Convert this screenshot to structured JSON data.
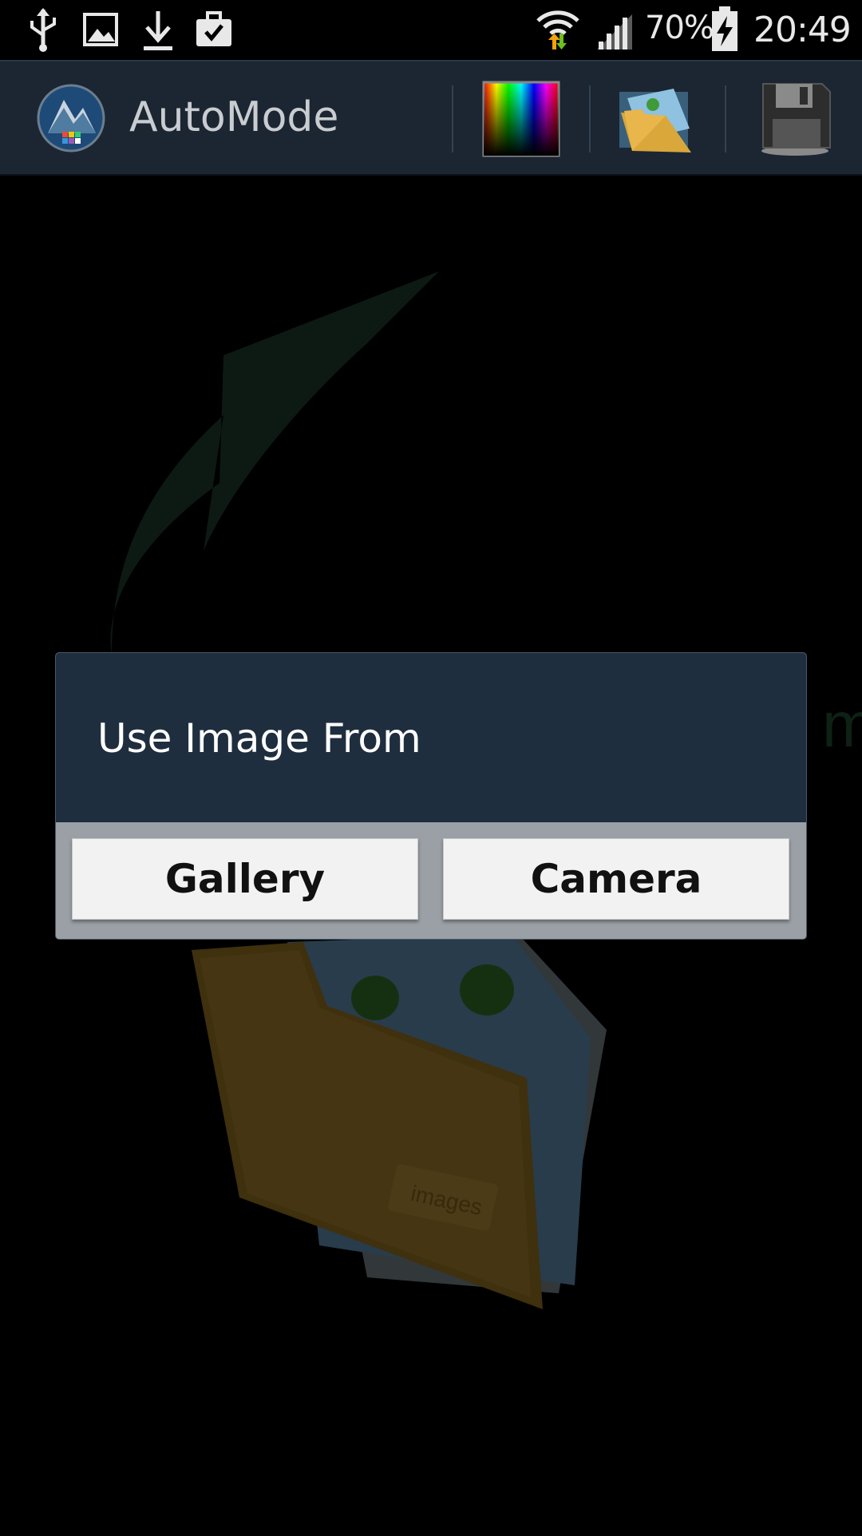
{
  "status_bar": {
    "icons": [
      "usb-icon",
      "image-icon",
      "download-icon",
      "briefcase-check-icon",
      "wifi-icon",
      "signal-icon",
      "battery-charging-icon"
    ],
    "battery_percent": "70%",
    "time": "20:49"
  },
  "action_bar": {
    "title": "AutoMode",
    "actions": [
      "color-picker-icon",
      "open-folder-icon",
      "save-icon"
    ]
  },
  "background": {
    "folder_label": "images"
  },
  "dialog": {
    "title": "Use Image From",
    "gallery_label": "Gallery",
    "camera_label": "Camera"
  },
  "colors": {
    "action_bar": "#1b2632",
    "dialog_header": "#1f2e3e",
    "dialog_body": "#9aa0a6",
    "button": "#f2f2f2",
    "arrow": "#1e3a2a"
  }
}
